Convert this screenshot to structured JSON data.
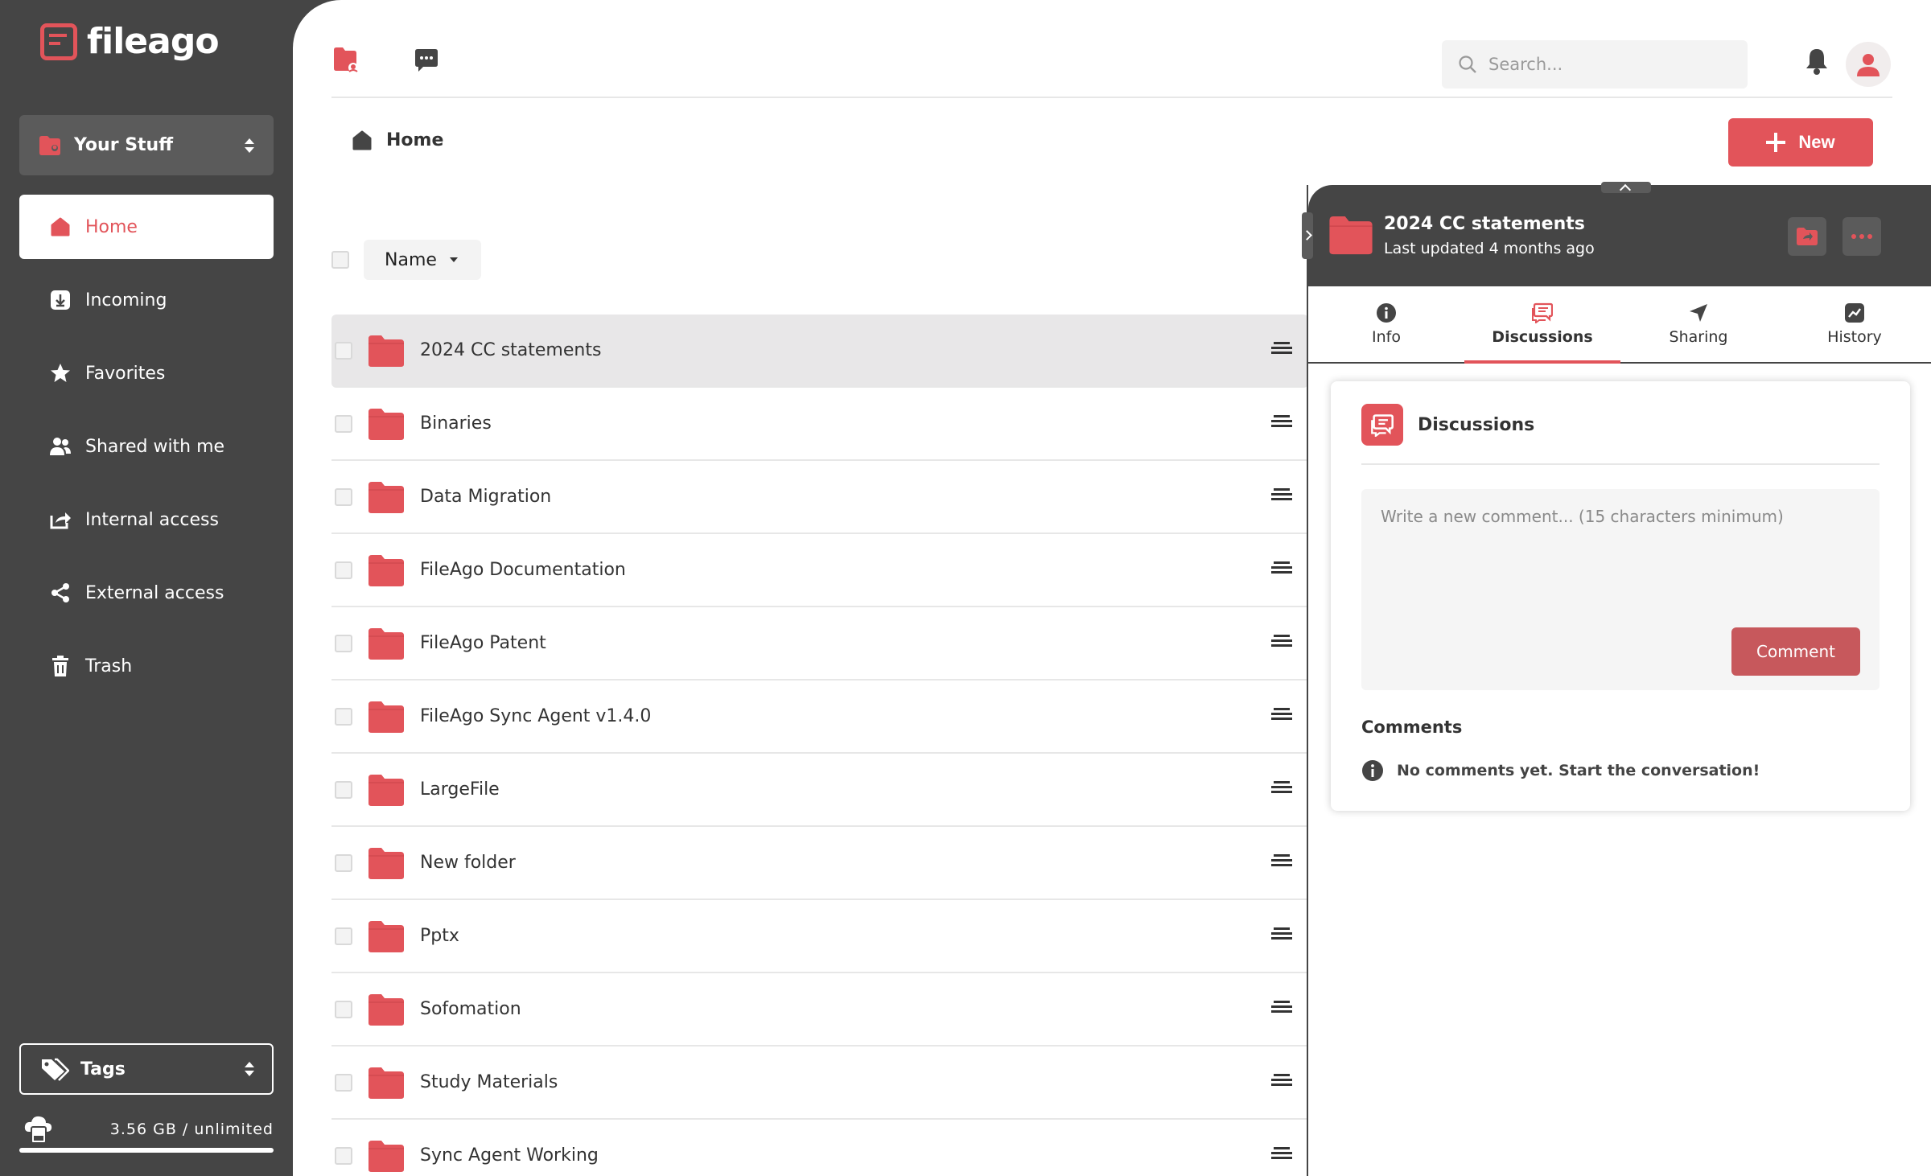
{
  "app": {
    "name": "fileago"
  },
  "colors": {
    "accent": "#e2545a",
    "sidebar": "#454545",
    "selected_row": "#e8e7e8"
  },
  "sidebar": {
    "space_selector": {
      "label": "Your Stuff",
      "icon": "folder-user-icon"
    },
    "items": [
      {
        "label": "Home",
        "icon": "home-icon",
        "active": true
      },
      {
        "label": "Incoming",
        "icon": "download-icon"
      },
      {
        "label": "Favorites",
        "icon": "star-icon"
      },
      {
        "label": "Shared with me",
        "icon": "users-icon"
      },
      {
        "label": "Internal access",
        "icon": "share-out-icon"
      },
      {
        "label": "External access",
        "icon": "share-nodes-icon"
      },
      {
        "label": "Trash",
        "icon": "trash-icon"
      }
    ],
    "tags": {
      "label": "Tags",
      "icon": "tags-icon"
    },
    "storage": {
      "text": "3.56 GB / unlimited",
      "icon": "cloud-drive-icon"
    }
  },
  "topbar": {
    "files_icon": "files-icon",
    "chat_icon": "chat-icon",
    "search": {
      "placeholder": "Search..."
    },
    "bell_icon": "bell-icon",
    "avatar_icon": "user-avatar-icon"
  },
  "breadcrumb": {
    "label": "Home",
    "icon": "home-icon"
  },
  "new_button": {
    "label": "New"
  },
  "list": {
    "sort_label": "Name",
    "rows": [
      {
        "name": "2024 CC statements",
        "selected": true
      },
      {
        "name": "Binaries"
      },
      {
        "name": "Data Migration"
      },
      {
        "name": "FileAgo Documentation"
      },
      {
        "name": "FileAgo Patent"
      },
      {
        "name": "FileAgo Sync Agent v1.4.0"
      },
      {
        "name": "LargeFile"
      },
      {
        "name": "New folder"
      },
      {
        "name": "Pptx"
      },
      {
        "name": "Sofomation"
      },
      {
        "name": "Study Materials"
      },
      {
        "name": "Sync Agent Working"
      }
    ]
  },
  "panel": {
    "title": "2024 CC statements",
    "subtitle": "Last updated 4 months ago",
    "tabs": [
      {
        "label": "Info",
        "icon": "info-icon"
      },
      {
        "label": "Discussions",
        "icon": "comments-icon",
        "active": true
      },
      {
        "label": "Sharing",
        "icon": "send-icon"
      },
      {
        "label": "History",
        "icon": "chart-line-icon"
      }
    ],
    "discussions": {
      "title": "Discussions",
      "placeholder": "Write a new comment... (15 characters minimum)",
      "button": "Comment",
      "comments_label": "Comments",
      "empty": "No comments yet. Start the conversation!"
    }
  }
}
